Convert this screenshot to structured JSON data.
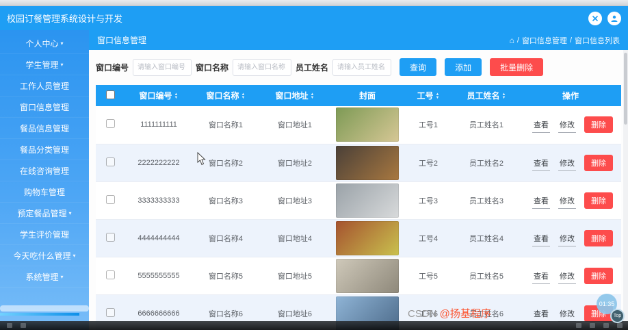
{
  "colors": {
    "primary": "#1e9ef4",
    "danger": "#fd4c4c",
    "row_alt": "#edf3fc",
    "watermark_gray": "#9a9a9a",
    "watermark_red": "#fc5531"
  },
  "icons": {
    "caret_down": "▾",
    "sort_asc": "▲",
    "sort_desc": "▼",
    "home": "⌂"
  },
  "header": {
    "title": "校园订餐管理系统设计与开发"
  },
  "page_header": {
    "title": "窗口信息管理",
    "breadcrumb": {
      "separator": "/",
      "items": [
        "窗口信息管理",
        "窗口信息列表"
      ]
    }
  },
  "sidebar": {
    "items": [
      {
        "label": "个人中心",
        "caret": true
      },
      {
        "label": "学生管理",
        "caret": true
      },
      {
        "label": "工作人员管理",
        "caret": false
      },
      {
        "label": "窗口信息管理",
        "caret": false
      },
      {
        "label": "餐品信息管理",
        "caret": false
      },
      {
        "label": "餐品分类管理",
        "caret": false
      },
      {
        "label": "在线咨询管理",
        "caret": false
      },
      {
        "label": "购物车管理",
        "caret": false
      },
      {
        "label": "预定餐品管理",
        "caret": true
      },
      {
        "label": "学生评价管理",
        "caret": false
      },
      {
        "label": "今天吃什么管理",
        "caret": true
      },
      {
        "label": "系统管理",
        "caret": true
      }
    ]
  },
  "search": {
    "fields": [
      {
        "label": "窗口编号",
        "placeholder": "请输入窗口编号"
      },
      {
        "label": "窗口名称",
        "placeholder": "请输入窗口名称"
      },
      {
        "label": "员工姓名",
        "placeholder": "请输入员工姓名"
      }
    ],
    "buttons": {
      "query": "查询",
      "add": "添加",
      "batch_delete": "批量删除"
    }
  },
  "table": {
    "columns": [
      {
        "type": "checkbox",
        "label": "",
        "sortable": false
      },
      {
        "key": "window_no",
        "label": "窗口编号",
        "sortable": true
      },
      {
        "key": "window_name",
        "label": "窗口名称",
        "sortable": true
      },
      {
        "key": "window_address",
        "label": "窗口地址",
        "sortable": true
      },
      {
        "key": "cover",
        "label": "封面",
        "sortable": false
      },
      {
        "key": "job_no",
        "label": "工号",
        "sortable": true
      },
      {
        "key": "employee_name",
        "label": "员工姓名",
        "sortable": true
      },
      {
        "key": "ops",
        "label": "操作",
        "sortable": false
      }
    ],
    "actions": {
      "view": "查看",
      "edit": "修改",
      "delete": "删除"
    },
    "rows": [
      {
        "window_no": "1111111111",
        "window_name": "窗口名称1",
        "window_address": "窗口地址1",
        "cover_gradient": [
          "#7d9a55",
          "#d6c795"
        ],
        "job_no": "工号1",
        "employee_name": "员工姓名1"
      },
      {
        "window_no": "2222222222",
        "window_name": "窗口名称2",
        "window_address": "窗口地址2",
        "cover_gradient": [
          "#4a4038",
          "#a87840"
        ],
        "job_no": "工号2",
        "employee_name": "员工姓名2"
      },
      {
        "window_no": "3333333333",
        "window_name": "窗口名称3",
        "window_address": "窗口地址3",
        "cover_gradient": [
          "#9aa2a8",
          "#d8dadb"
        ],
        "job_no": "工号3",
        "employee_name": "员工姓名3"
      },
      {
        "window_no": "4444444444",
        "window_name": "窗口名称4",
        "window_address": "窗口地址4",
        "cover_gradient": [
          "#a5522f",
          "#c9c14e"
        ],
        "job_no": "工号4",
        "employee_name": "员工姓名4"
      },
      {
        "window_no": "5555555555",
        "window_name": "窗口名称5",
        "window_address": "窗口地址5",
        "cover_gradient": [
          "#cfc9ba",
          "#8e887a"
        ],
        "job_no": "工号5",
        "employee_name": "员工姓名5"
      },
      {
        "window_no": "6666666666",
        "window_name": "窗口名称6",
        "window_address": "窗口地址6",
        "cover_gradient": [
          "#8fb4d6",
          "#4d6b8a"
        ],
        "job_no": "工号6",
        "employee_name": "员工姓名6"
      }
    ]
  },
  "overlay": {
    "watermark_prefix": "CSDN ",
    "watermark_handle": "@扬基程序",
    "timer": "01:35",
    "top_label": "Top"
  }
}
